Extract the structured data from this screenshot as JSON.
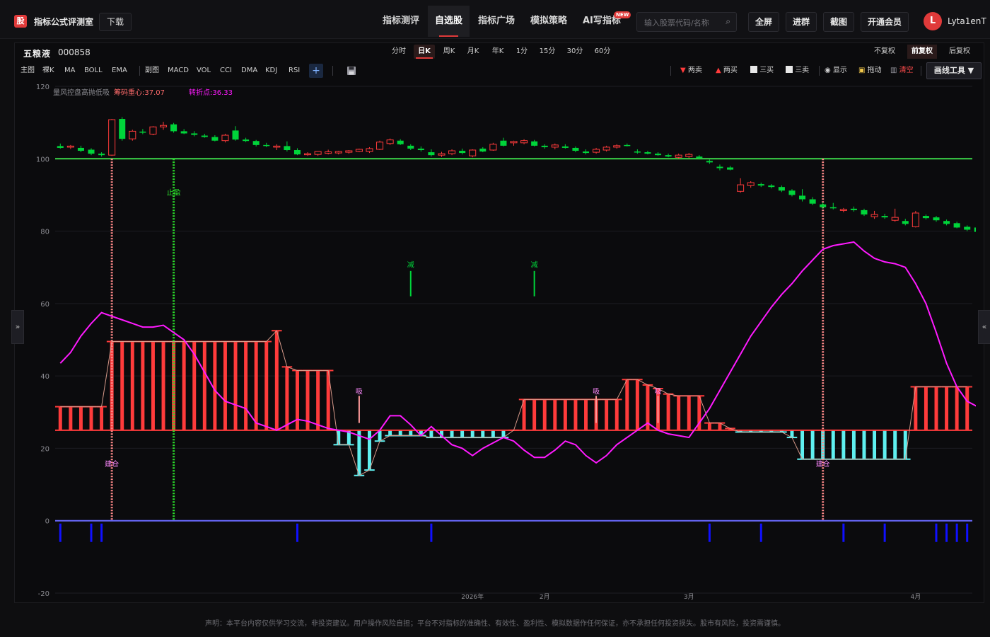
{
  "app": {
    "logo_text": "股",
    "name": "指标公式评测室",
    "download_label": "下载"
  },
  "nav": [
    {
      "label": "指标测评"
    },
    {
      "label": "自选股"
    },
    {
      "label": "指标广场"
    },
    {
      "label": "模拟策略"
    },
    {
      "label": "AI写指标",
      "badge": "NEW"
    }
  ],
  "search": {
    "placeholder": "输入股票代码/名称",
    "icon": "search-icon"
  },
  "top_buttons": [
    "全屏",
    "进群",
    "截图",
    "开通会员"
  ],
  "user": {
    "avatar_letter": "L",
    "name": "Lyta1enT"
  },
  "stock": {
    "name": "五粮液",
    "code": "000858"
  },
  "periods": [
    "分时",
    "日K",
    "周K",
    "月K",
    "年K",
    "1分",
    "15分",
    "30分",
    "60分"
  ],
  "active_period": "日K",
  "rights": [
    "不复权",
    "前复权",
    "后复权"
  ],
  "active_rights": "前复权",
  "main_indicators": [
    "主图",
    "裸K",
    "MA",
    "BOLL",
    "EMA"
  ],
  "sub_indicators": [
    "副图",
    "MACD",
    "VOL",
    "CCI",
    "DMA",
    "KDJ",
    "RSI"
  ],
  "add_label": "+",
  "save_icon": "save-icon",
  "tools": [
    {
      "label": "两卖",
      "icon": "triangle-down-icon",
      "color": "#ff3b3b"
    },
    {
      "label": "两买",
      "icon": "triangle-up-icon",
      "color": "#ff3b3b"
    },
    {
      "label": "三买",
      "icon": "line-chart-icon",
      "color": "#dddddd"
    },
    {
      "label": "三卖",
      "icon": "line-chart-icon",
      "color": "#dddddd"
    },
    {
      "label": "显示",
      "icon": "eye-icon",
      "color": "#dddddd"
    },
    {
      "label": "拖动",
      "icon": "lock-icon",
      "color": "#dddddd"
    },
    {
      "label": "清空",
      "icon": "trash-icon",
      "color": "#ff4b4b"
    }
  ],
  "draw_tools_label": "画线工具 ▼",
  "side_left": "»",
  "side_right": "«",
  "disclaimer": "声明：本平台内容仅供学习交流，非投资建议。用户操作风险自担；平台不对指标的准确性、有效性、盈利性、模拟数据作任何保证，亦不承担任何投资损失。股市有风险，投资需谨慎。",
  "colors": {
    "up": "#ff3b3b",
    "down": "#00d43a",
    "accent": "#e03a3a",
    "line_pink": "#ff1aff",
    "cyan": "#5ff0f0",
    "blue": "#1010ff",
    "level_green": "#3cd84a"
  },
  "chart_data": {
    "type": "candlestick",
    "indicator_legend": [
      {
        "label": "量风控盘高抛低吸",
        "color": "#8a8a90"
      },
      {
        "label": "筹码重心:37.07",
        "color": "#ff6b6b"
      },
      {
        "label": "转折点:36.33",
        "color": "#ff1aff"
      }
    ],
    "y_ticks": [
      120,
      100,
      80,
      60,
      40,
      20,
      0,
      -20
    ],
    "ylim": [
      -20,
      120
    ],
    "x_tick_labels": [
      {
        "label": "2026年",
        "index": 40
      },
      {
        "label": "2月",
        "index": 47
      },
      {
        "label": "3月",
        "index": 61
      },
      {
        "label": "4月",
        "index": 83
      }
    ],
    "n_bars": 89,
    "level_line": 100,
    "baseline": 0,
    "candles": [
      {
        "o": 103.5,
        "h": 104.2,
        "l": 102.8,
        "c": 103.0
      },
      {
        "o": 103.2,
        "h": 103.8,
        "l": 102.7,
        "c": 103.5
      },
      {
        "o": 103.0,
        "h": 103.6,
        "l": 101.8,
        "c": 102.2
      },
      {
        "o": 102.5,
        "h": 102.9,
        "l": 101.0,
        "c": 101.4
      },
      {
        "o": 101.4,
        "h": 101.8,
        "l": 100.6,
        "c": 101.0
      },
      {
        "o": 101.0,
        "h": 111.0,
        "l": 100.8,
        "c": 110.8
      },
      {
        "o": 111.0,
        "h": 111.5,
        "l": 105.0,
        "c": 105.5
      },
      {
        "o": 105.5,
        "h": 108.0,
        "l": 105.0,
        "c": 107.6
      },
      {
        "o": 107.5,
        "h": 108.2,
        "l": 106.8,
        "c": 107.2
      },
      {
        "o": 106.8,
        "h": 109.0,
        "l": 106.5,
        "c": 108.8
      },
      {
        "o": 108.8,
        "h": 110.2,
        "l": 108.0,
        "c": 109.2
      },
      {
        "o": 109.5,
        "h": 109.9,
        "l": 107.2,
        "c": 107.6
      },
      {
        "o": 107.6,
        "h": 108.2,
        "l": 106.8,
        "c": 107.0
      },
      {
        "o": 107.0,
        "h": 107.6,
        "l": 106.2,
        "c": 106.6
      },
      {
        "o": 106.4,
        "h": 106.9,
        "l": 105.8,
        "c": 106.0
      },
      {
        "o": 106.0,
        "h": 106.5,
        "l": 104.8,
        "c": 105.0
      },
      {
        "o": 105.0,
        "h": 106.9,
        "l": 104.5,
        "c": 106.5
      },
      {
        "o": 107.8,
        "h": 109.0,
        "l": 105.0,
        "c": 105.3
      },
      {
        "o": 105.3,
        "h": 105.8,
        "l": 104.6,
        "c": 104.9
      },
      {
        "o": 104.9,
        "h": 105.2,
        "l": 103.4,
        "c": 103.8
      },
      {
        "o": 103.8,
        "h": 104.4,
        "l": 103.2,
        "c": 103.6
      },
      {
        "o": 103.2,
        "h": 104.0,
        "l": 102.4,
        "c": 103.5
      },
      {
        "o": 103.5,
        "h": 104.8,
        "l": 102.0,
        "c": 102.4
      },
      {
        "o": 102.4,
        "h": 102.9,
        "l": 101.0,
        "c": 101.2
      },
      {
        "o": 101.2,
        "h": 101.8,
        "l": 100.8,
        "c": 101.4
      },
      {
        "o": 101.2,
        "h": 102.0,
        "l": 100.8,
        "c": 102.0
      },
      {
        "o": 101.5,
        "h": 102.5,
        "l": 101.2,
        "c": 101.9
      },
      {
        "o": 101.6,
        "h": 102.2,
        "l": 101.2,
        "c": 102.0
      },
      {
        "o": 101.8,
        "h": 102.4,
        "l": 101.4,
        "c": 102.2
      },
      {
        "o": 102.0,
        "h": 102.8,
        "l": 101.8,
        "c": 102.6
      },
      {
        "o": 102.0,
        "h": 103.2,
        "l": 101.6,
        "c": 102.8
      },
      {
        "o": 102.6,
        "h": 105.0,
        "l": 102.4,
        "c": 104.6
      },
      {
        "o": 104.2,
        "h": 105.6,
        "l": 103.8,
        "c": 105.2
      },
      {
        "o": 105.0,
        "h": 105.4,
        "l": 103.8,
        "c": 104.0
      },
      {
        "o": 103.6,
        "h": 104.0,
        "l": 102.4,
        "c": 102.8
      },
      {
        "o": 102.8,
        "h": 103.4,
        "l": 102.0,
        "c": 102.4
      },
      {
        "o": 101.8,
        "h": 102.6,
        "l": 100.6,
        "c": 101.0
      },
      {
        "o": 101.0,
        "h": 101.9,
        "l": 100.5,
        "c": 101.4
      },
      {
        "o": 101.4,
        "h": 102.6,
        "l": 101.0,
        "c": 102.2
      },
      {
        "o": 102.2,
        "h": 102.8,
        "l": 101.2,
        "c": 101.6
      },
      {
        "o": 100.8,
        "h": 102.6,
        "l": 100.4,
        "c": 102.4
      },
      {
        "o": 102.8,
        "h": 103.2,
        "l": 101.8,
        "c": 102.0
      },
      {
        "o": 102.4,
        "h": 104.4,
        "l": 102.2,
        "c": 104.0
      },
      {
        "o": 105.0,
        "h": 105.8,
        "l": 103.4,
        "c": 103.6
      },
      {
        "o": 104.4,
        "h": 105.0,
        "l": 103.6,
        "c": 104.8
      },
      {
        "o": 104.4,
        "h": 105.4,
        "l": 104.0,
        "c": 105.0
      },
      {
        "o": 104.8,
        "h": 105.2,
        "l": 103.4,
        "c": 103.6
      },
      {
        "o": 103.6,
        "h": 104.0,
        "l": 102.8,
        "c": 103.2
      },
      {
        "o": 103.2,
        "h": 104.2,
        "l": 102.6,
        "c": 103.8
      },
      {
        "o": 103.4,
        "h": 104.0,
        "l": 102.8,
        "c": 103.0
      },
      {
        "o": 103.0,
        "h": 103.4,
        "l": 101.8,
        "c": 102.2
      },
      {
        "o": 102.0,
        "h": 102.6,
        "l": 101.2,
        "c": 101.6
      },
      {
        "o": 101.8,
        "h": 103.0,
        "l": 101.4,
        "c": 102.6
      },
      {
        "o": 102.4,
        "h": 103.6,
        "l": 102.0,
        "c": 103.2
      },
      {
        "o": 103.2,
        "h": 104.0,
        "l": 102.8,
        "c": 103.6
      },
      {
        "o": 103.8,
        "h": 104.2,
        "l": 103.4,
        "c": 103.6
      },
      {
        "o": 102.0,
        "h": 102.6,
        "l": 101.4,
        "c": 101.8
      },
      {
        "o": 101.8,
        "h": 102.2,
        "l": 101.2,
        "c": 101.4
      },
      {
        "o": 101.4,
        "h": 101.8,
        "l": 100.8,
        "c": 101.0
      },
      {
        "o": 101.0,
        "h": 101.4,
        "l": 100.4,
        "c": 100.6
      },
      {
        "o": 100.4,
        "h": 101.4,
        "l": 100.0,
        "c": 101.0
      },
      {
        "o": 100.6,
        "h": 101.6,
        "l": 100.2,
        "c": 101.2
      },
      {
        "o": 100.6,
        "h": 101.0,
        "l": 99.8,
        "c": 100.2
      },
      {
        "o": 99.4,
        "h": 99.8,
        "l": 98.6,
        "c": 99.0
      },
      {
        "o": 97.8,
        "h": 98.4,
        "l": 96.8,
        "c": 97.4
      },
      {
        "o": 97.6,
        "h": 98.0,
        "l": 96.8,
        "c": 97.0
      },
      {
        "o": 91.0,
        "h": 94.6,
        "l": 90.6,
        "c": 92.8
      },
      {
        "o": 92.6,
        "h": 93.8,
        "l": 92.0,
        "c": 93.4
      },
      {
        "o": 93.0,
        "h": 93.4,
        "l": 92.2,
        "c": 92.6
      },
      {
        "o": 92.6,
        "h": 93.0,
        "l": 91.8,
        "c": 92.2
      },
      {
        "o": 92.2,
        "h": 92.6,
        "l": 90.8,
        "c": 91.2
      },
      {
        "o": 91.2,
        "h": 91.6,
        "l": 89.6,
        "c": 90.0
      },
      {
        "o": 89.8,
        "h": 91.6,
        "l": 88.2,
        "c": 88.8
      },
      {
        "o": 88.8,
        "h": 89.4,
        "l": 87.2,
        "c": 87.6
      },
      {
        "o": 87.4,
        "h": 87.9,
        "l": 86.2,
        "c": 86.6
      },
      {
        "o": 86.6,
        "h": 87.8,
        "l": 86.0,
        "c": 86.4
      },
      {
        "o": 85.8,
        "h": 86.4,
        "l": 85.2,
        "c": 86.0
      },
      {
        "o": 86.2,
        "h": 86.8,
        "l": 85.4,
        "c": 85.8
      },
      {
        "o": 85.8,
        "h": 86.2,
        "l": 84.2,
        "c": 84.6
      },
      {
        "o": 84.0,
        "h": 85.6,
        "l": 83.4,
        "c": 84.6
      },
      {
        "o": 84.2,
        "h": 84.8,
        "l": 83.4,
        "c": 83.8
      },
      {
        "o": 83.0,
        "h": 86.2,
        "l": 82.6,
        "c": 83.8
      },
      {
        "o": 82.8,
        "h": 83.4,
        "l": 81.6,
        "c": 82.0
      },
      {
        "o": 81.2,
        "h": 85.6,
        "l": 81.0,
        "c": 85.0
      },
      {
        "o": 84.2,
        "h": 84.6,
        "l": 83.2,
        "c": 83.6
      },
      {
        "o": 83.8,
        "h": 84.2,
        "l": 82.6,
        "c": 83.0
      },
      {
        "o": 82.8,
        "h": 83.2,
        "l": 81.6,
        "c": 82.0
      },
      {
        "o": 82.2,
        "h": 82.6,
        "l": 80.8,
        "c": 81.0
      },
      {
        "o": 81.2,
        "h": 81.6,
        "l": 80.0,
        "c": 80.4
      },
      {
        "o": 81.0,
        "h": 81.4,
        "l": 79.4,
        "c": 79.8
      },
      {
        "o": 79.8,
        "h": 80.2,
        "l": 78.8,
        "c": 79.2
      },
      {
        "o": 79.0,
        "h": 79.8,
        "l": 78.6,
        "c": 79.4
      }
    ],
    "zone_base": 25,
    "zone_levels": [
      31.5,
      31.5,
      31.5,
      31.5,
      31.5,
      49.5,
      49.5,
      49.5,
      49.5,
      49.5,
      49.5,
      49.5,
      49.5,
      49.5,
      49.5,
      49.5,
      49.5,
      49.5,
      49.5,
      49.5,
      49.5,
      52.5,
      42.5,
      41.5,
      41.5,
      41.5,
      41.5,
      21.0,
      21.0,
      12.5,
      14.0,
      22.0,
      23.5,
      23.5,
      23.5,
      23.5,
      23.0,
      23.0,
      23.0,
      23.0,
      23.0,
      23.0,
      23.0,
      23.0,
      25.0,
      33.5,
      33.5,
      33.5,
      33.5,
      33.5,
      33.5,
      33.5,
      33.5,
      33.5,
      33.5,
      39.0,
      39.0,
      37.5,
      36.5,
      35.0,
      34.5,
      34.5,
      34.5,
      27.0,
      27.0,
      25.5,
      24.5,
      24.5,
      24.5,
      24.5,
      24.5,
      23.0,
      17.0,
      17.0,
      17.0,
      17.0,
      17.0,
      17.0,
      17.0,
      17.0,
      17.0,
      17.0,
      17.0,
      37.0,
      37.0,
      37.0,
      37.0,
      37.0,
      37.0
    ],
    "pink_line": [
      43.5,
      46.5,
      51.0,
      54.5,
      57.5,
      56.5,
      55.5,
      54.5,
      53.5,
      53.5,
      54.0,
      52.0,
      50.0,
      46.0,
      41.0,
      36.0,
      33.0,
      32.0,
      31.0,
      27.0,
      26.0,
      25.0,
      26.5,
      28.0,
      27.5,
      26.5,
      25.5,
      25.0,
      24.5,
      23.5,
      22.5,
      25.0,
      29.0,
      29.0,
      26.5,
      23.5,
      26.0,
      23.5,
      21.0,
      20.0,
      18.0,
      20.0,
      21.5,
      23.0,
      22.0,
      19.5,
      17.5,
      17.5,
      19.5,
      22.0,
      21.0,
      18.0,
      16.0,
      18.0,
      21.0,
      23.0,
      25.0,
      27.0,
      25.0,
      24.0,
      23.5,
      23.0,
      27.0,
      31.0,
      36.0,
      41.0,
      46.0,
      51.0,
      55.0,
      59.0,
      62.5,
      65.5,
      69.0,
      72.0,
      75.0,
      76.0,
      76.5,
      77.0,
      74.5,
      72.5,
      71.5,
      71.0,
      70.0,
      65.5,
      60.0,
      52.0,
      43.5,
      37.0,
      33.0,
      31.5,
      33.0,
      35.0,
      37.0
    ],
    "vertical_markers": [
      {
        "index": 5,
        "color": "#ff8a8a",
        "label": "建仓"
      },
      {
        "index": 11,
        "color": "#2be02b",
        "label": "止盈"
      },
      {
        "index": 74,
        "color": "#ff8a8a",
        "label": "建仓"
      }
    ],
    "signals_green": [
      {
        "index": 34,
        "label": "减"
      },
      {
        "index": 46,
        "label": "减"
      }
    ],
    "signals_pink": [
      {
        "index": 29,
        "label": "吸"
      },
      {
        "index": 52,
        "label": "吸"
      },
      {
        "index": 58,
        "label": "吸"
      }
    ],
    "blue_ticks": [
      0,
      3,
      4,
      23,
      36,
      63,
      68,
      76,
      80,
      85,
      86,
      87,
      88
    ]
  }
}
